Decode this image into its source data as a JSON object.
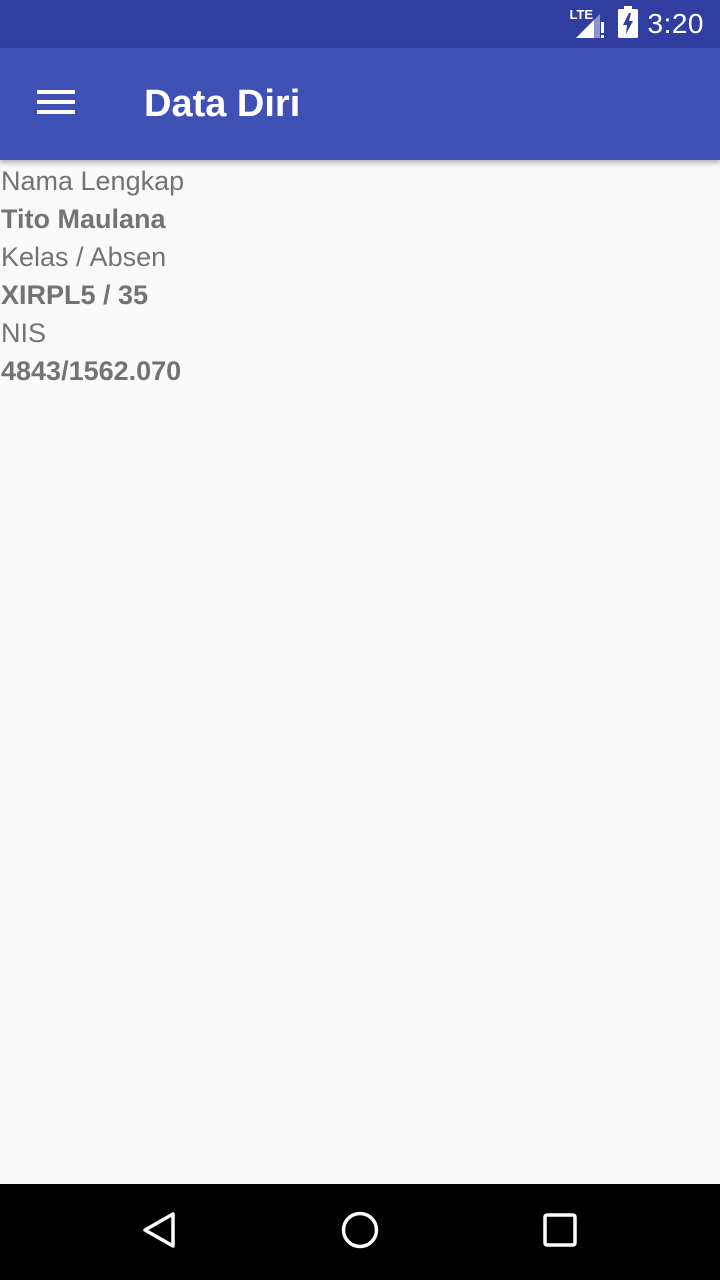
{
  "status_bar": {
    "network_label": "LTE",
    "time": "3:20",
    "icons": [
      "lte-signal-icon",
      "battery-charging-icon"
    ]
  },
  "app_bar": {
    "title": "Data Diri",
    "menu_icon": "hamburger-menu-icon",
    "background_color": "#3f51b5",
    "status_color": "#303f9f"
  },
  "profile": {
    "fields": [
      {
        "label": "Nama Lengkap",
        "value": "Tito Maulana"
      },
      {
        "label": "Kelas / Absen",
        "value": "XIRPL5 / 35"
      },
      {
        "label": "NIS",
        "value": "4843/1562.070"
      }
    ]
  },
  "nav_bar": {
    "icons": [
      "back-icon",
      "home-icon",
      "recents-icon"
    ]
  }
}
